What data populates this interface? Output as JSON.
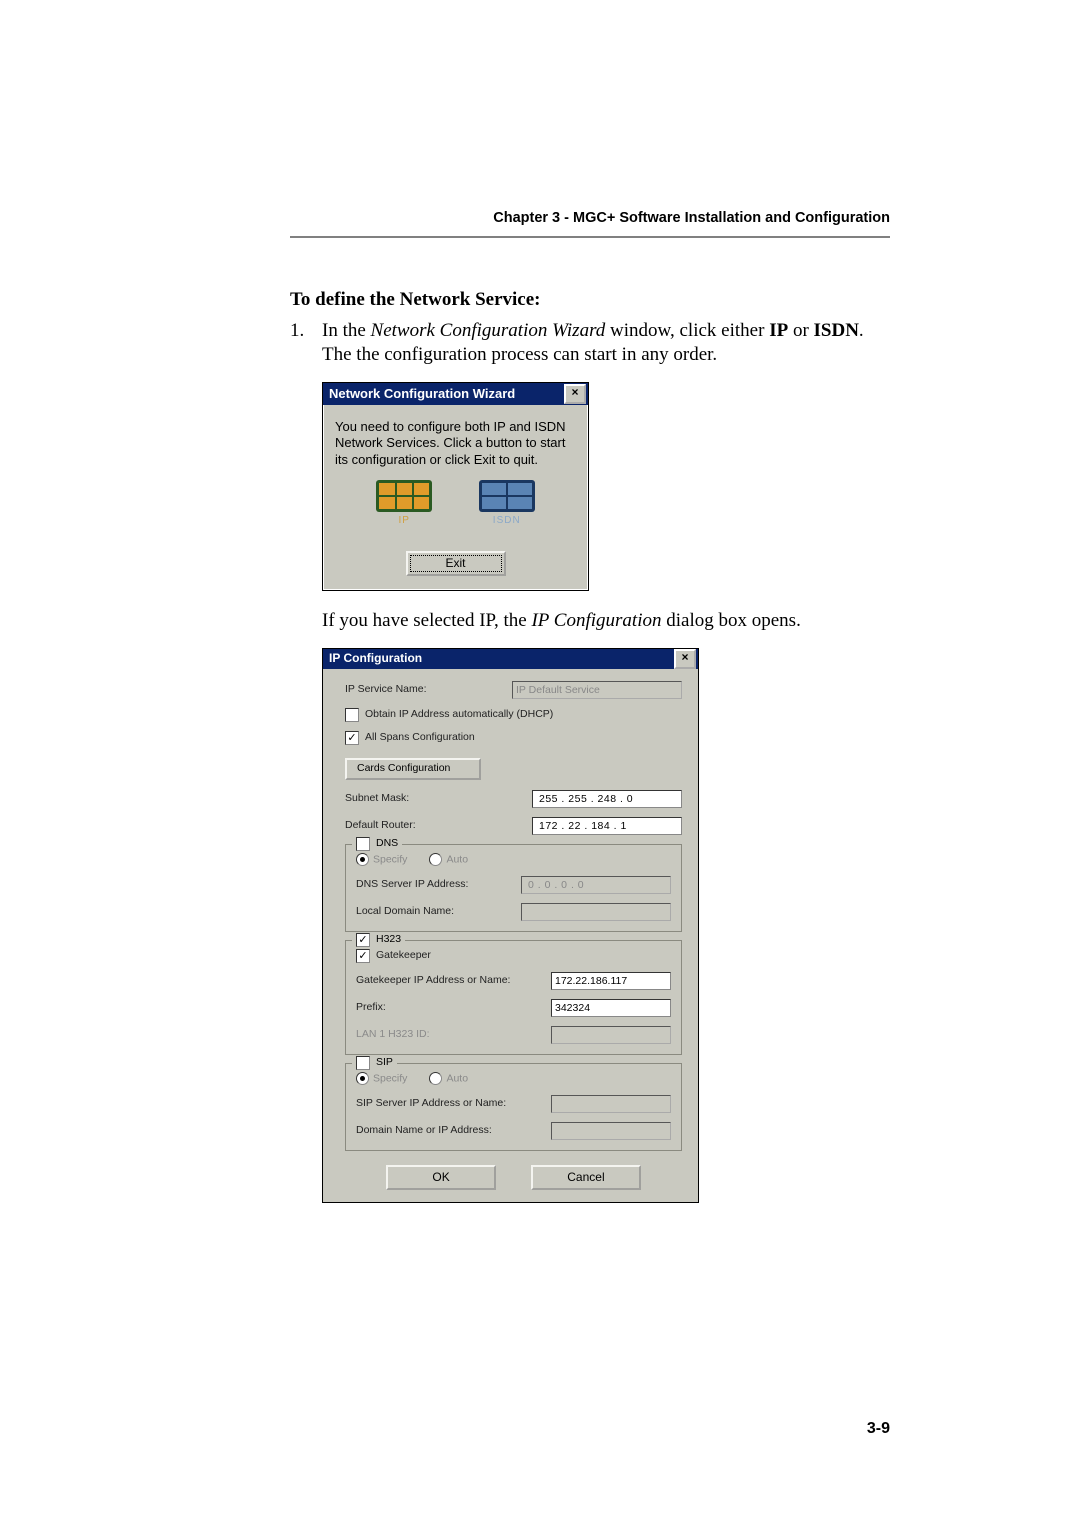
{
  "header": "Chapter 3 - MGC+ Software Installation and Configuration",
  "section_title": "To define the Network Service:",
  "step": {
    "num": "1.",
    "pre": "In the ",
    "wizard_name": "Network Configuration Wizard",
    "mid1": " window, click either ",
    "ip": "IP",
    "or": " or ",
    "isdn": "ISDN",
    "end": ". The the configuration process can start in any order."
  },
  "after_wizard": {
    "pre": "If you have selected IP, the ",
    "dialog": "IP Configuration",
    "post": " dialog box opens."
  },
  "wiz": {
    "title": "Network Configuration Wizard",
    "close": "×",
    "message": "You need to configure both IP and ISDN Network Services. Click a button to start its configuration or click Exit to quit.",
    "btn_ip": "IP",
    "btn_isdn": "ISDN",
    "exit": "Exit"
  },
  "ipc": {
    "title": "IP Configuration",
    "close": "×",
    "service_name_label": "IP Service Name:",
    "service_name_value": "IP Default Service",
    "dhcp_label": "Obtain IP Address automatically (DHCP)",
    "allspans_label": "All Spans Configuration",
    "cards_btn": "Cards Configuration",
    "subnet_label": "Subnet Mask:",
    "subnet_value": "255 . 255 . 248 .   0",
    "router_label": "Default Router:",
    "router_value": "172 .  22 . 184 .   1",
    "dns": {
      "legend": "DNS",
      "specify": "Specify",
      "auto": "Auto",
      "server_label": "DNS Server IP Address:",
      "server_value": "0  .   0  .   0  .   0",
      "local_label": "Local Domain Name:",
      "local_value": ""
    },
    "h323": {
      "legend": "H323",
      "gatekeeper": "Gatekeeper",
      "gk_addr_label": "Gatekeeper IP Address or Name:",
      "gk_addr_value": "172.22.186.117",
      "prefix_label": "Prefix:",
      "prefix_value": "342324",
      "lan_label": "LAN 1 H323 ID:",
      "lan_value": ""
    },
    "sip": {
      "legend": "SIP",
      "specify": "Specify",
      "auto": "Auto",
      "server_label": "SIP Server IP Address or Name:",
      "server_value": "",
      "domain_label": "Domain Name or IP Address:",
      "domain_value": ""
    },
    "ok": "OK",
    "cancel": "Cancel"
  },
  "page_number": "3-9"
}
